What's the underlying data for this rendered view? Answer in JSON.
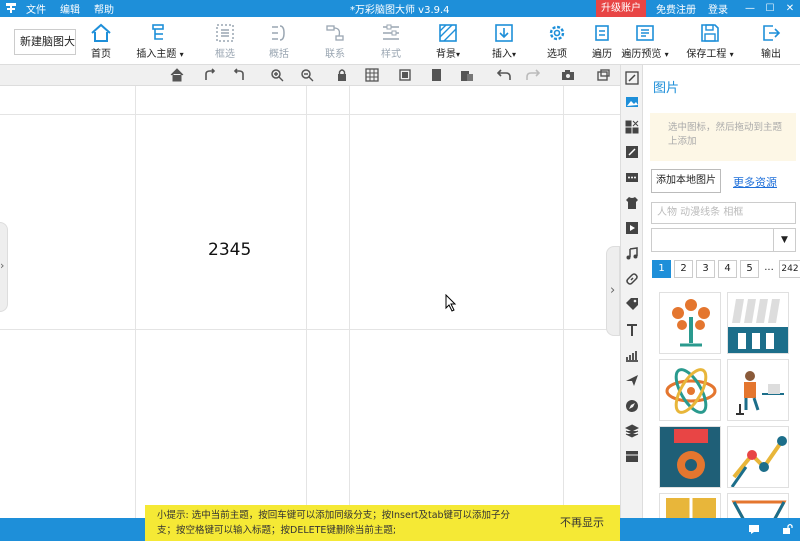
{
  "window": {
    "menu": [
      "文件",
      "编辑",
      "帮助"
    ],
    "title": "*万彩脑图大师 v3.9.4",
    "upgrade": "升级账户",
    "register": "免费注册",
    "login": "登录"
  },
  "toolbar": {
    "doc_name": "新建脑图大",
    "items": [
      {
        "label": "首页",
        "icon": "home-icon"
      },
      {
        "label": "插入主题",
        "icon": "insert-topic-icon"
      },
      {
        "label": "框选",
        "icon": "frame-select-icon"
      },
      {
        "label": "概括",
        "icon": "summary-icon"
      },
      {
        "label": "联系",
        "icon": "relation-icon"
      },
      {
        "label": "样式",
        "icon": "style-icon"
      },
      {
        "label": "背景",
        "icon": "background-icon"
      },
      {
        "label": "插入",
        "icon": "insert-icon"
      },
      {
        "label": "选项",
        "icon": "gear-icon"
      },
      {
        "label": "遍历",
        "icon": "traverse-icon"
      },
      {
        "label": "遍历预览",
        "icon": "traverse-preview-icon"
      },
      {
        "label": "保存工程",
        "icon": "save-icon"
      },
      {
        "label": "输出",
        "icon": "export-icon"
      }
    ]
  },
  "canvas": {
    "topic_text": "2345"
  },
  "panel": {
    "title": "图片",
    "tip": "选中图标，然后拖动到主题上添加",
    "add_local": "添加本地图片",
    "more": "更多资源",
    "search_placeholder": "人物 动漫线条 相框",
    "pages": [
      "1",
      "2",
      "3",
      "4",
      "5",
      "...",
      "242"
    ],
    "active_page": "1"
  },
  "tipbar": {
    "line1": "小提示: 选中当前主题，按回车键可以添加同级分支；按Insert及tab键可以添加子分",
    "line2": "支；按空格键可以输入标题；按DELETE键删除当前主题;",
    "close": "不再显示"
  },
  "colors": {
    "brand": "#1e8fd9",
    "upgrade": "#e84545",
    "tip_bg": "#f5e935"
  }
}
